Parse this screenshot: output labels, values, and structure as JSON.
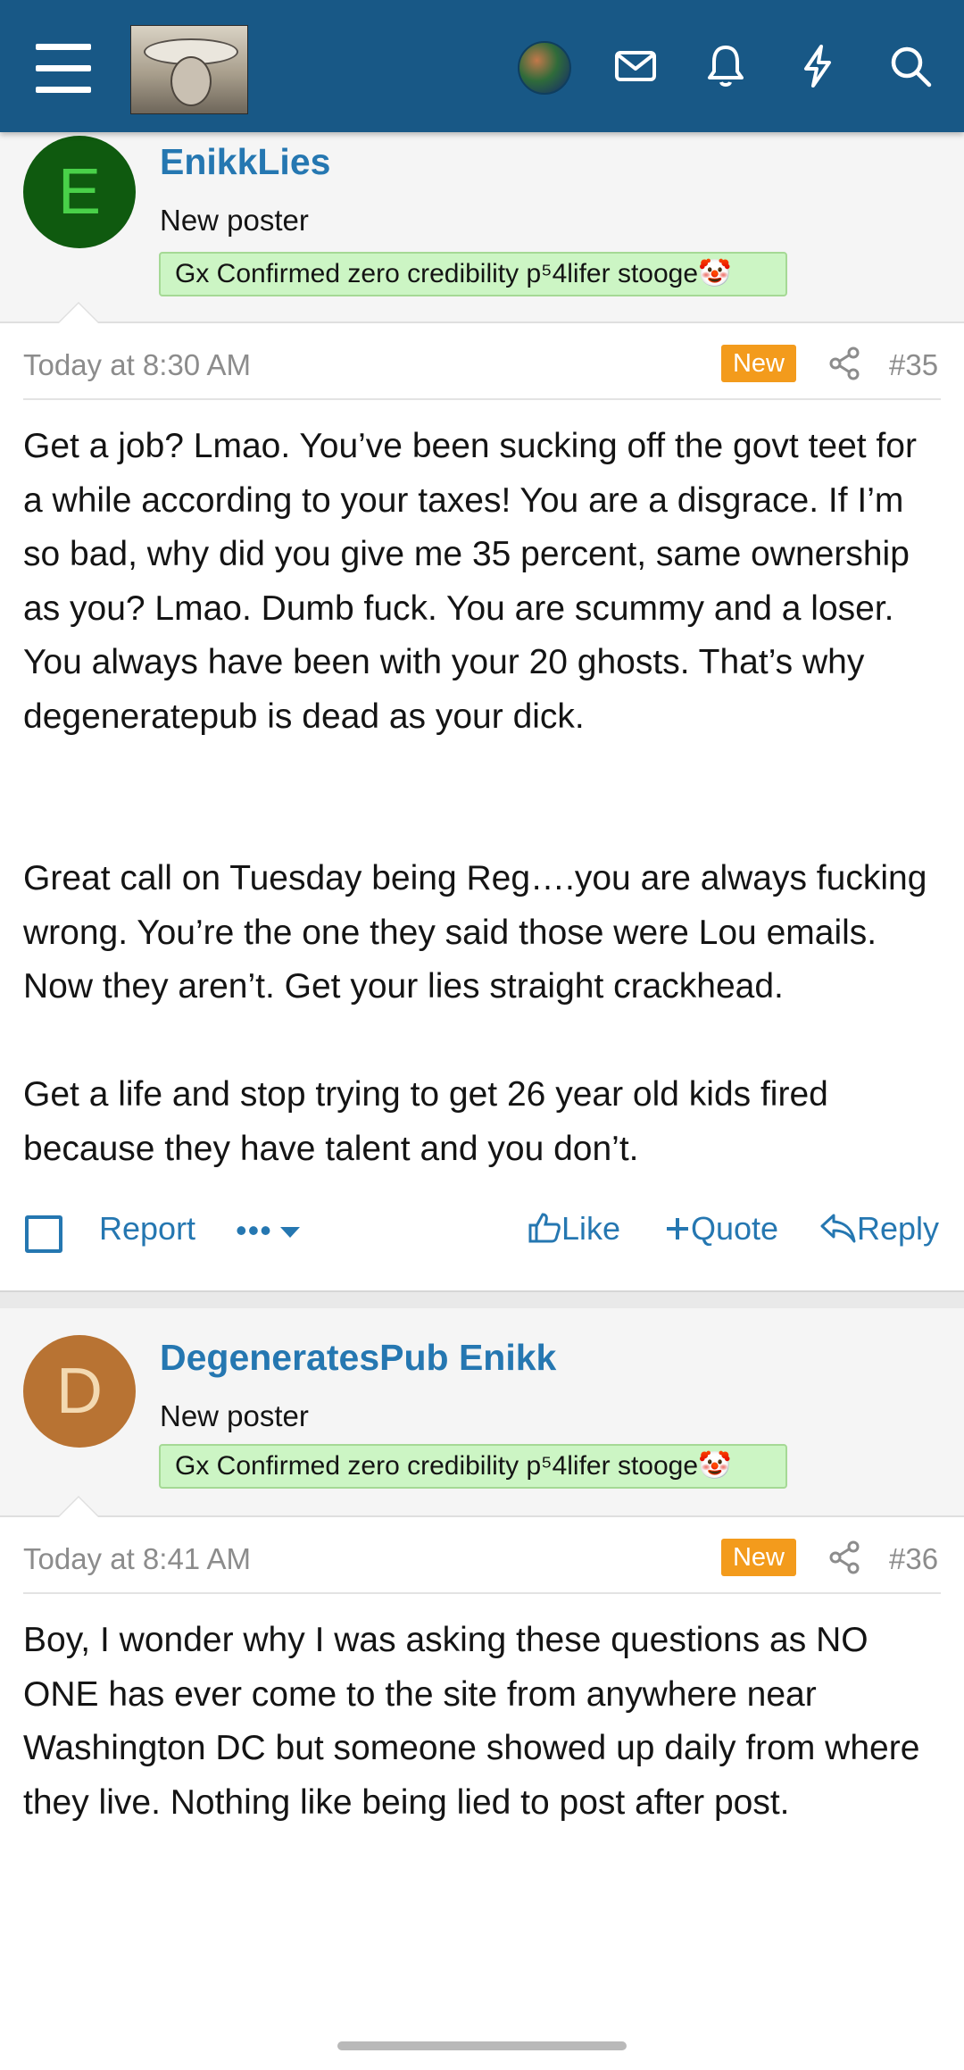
{
  "colors": {
    "header_bg": "#185886",
    "link": "#2577b1",
    "badge_new": "#f39b1c",
    "banner_bg": "#ccf5c4"
  },
  "header": {
    "icons": [
      "menu-icon",
      "site-logo",
      "user-avatar",
      "mail-icon",
      "bell-icon",
      "lightning-icon",
      "search-icon"
    ]
  },
  "posts": [
    {
      "avatar_letter": "E",
      "avatar_bg": "#0f5a0f",
      "avatar_fg": "#49d149",
      "username": "EnikkLies",
      "user_title": "New poster",
      "banner": "Gx Confirmed zero credibility p⁵4lifer stooge🤡",
      "timestamp": "Today at 8:30 AM",
      "badge": "New",
      "post_number": "#35",
      "paragraphs": [
        "Get a job? Lmao. You’ve been sucking off the govt teet for a while according to your taxes! You are a disgrace. If I’m so bad, why did you give me 35 percent, same ownership as you? Lmao. Dumb fuck. You are scummy and a loser. You always have been with your 20 ghosts. That’s why degeneratepub is dead as your dick.",
        "Great call on Tuesday being Reg….you are always fucking wrong. You’re the one they said those were Lou emails. Now they aren’t. Get your lies straight crackhead.",
        "Get a life and stop trying to get 26 year old kids fired because they have talent and you don’t."
      ],
      "actions": {
        "report": "Report",
        "more": "•••",
        "like": "Like",
        "quote": "Quote",
        "reply": "Reply"
      }
    },
    {
      "avatar_letter": "D",
      "avatar_bg": "#b87333",
      "avatar_fg": "#f3d9b1",
      "username": "DegeneratesPub Enikk",
      "user_title": "New poster",
      "banner": "Gx Confirmed zero credibility p⁵4lifer stooge🤡",
      "timestamp": "Today at 8:41 AM",
      "badge": "New",
      "post_number": "#36",
      "paragraphs": [
        "Boy, I wonder why I was asking these questions as NO ONE has ever come to the site from anywhere near Washington DC but someone showed up daily from where they live. Nothing like being lied to post after post."
      ]
    }
  ]
}
